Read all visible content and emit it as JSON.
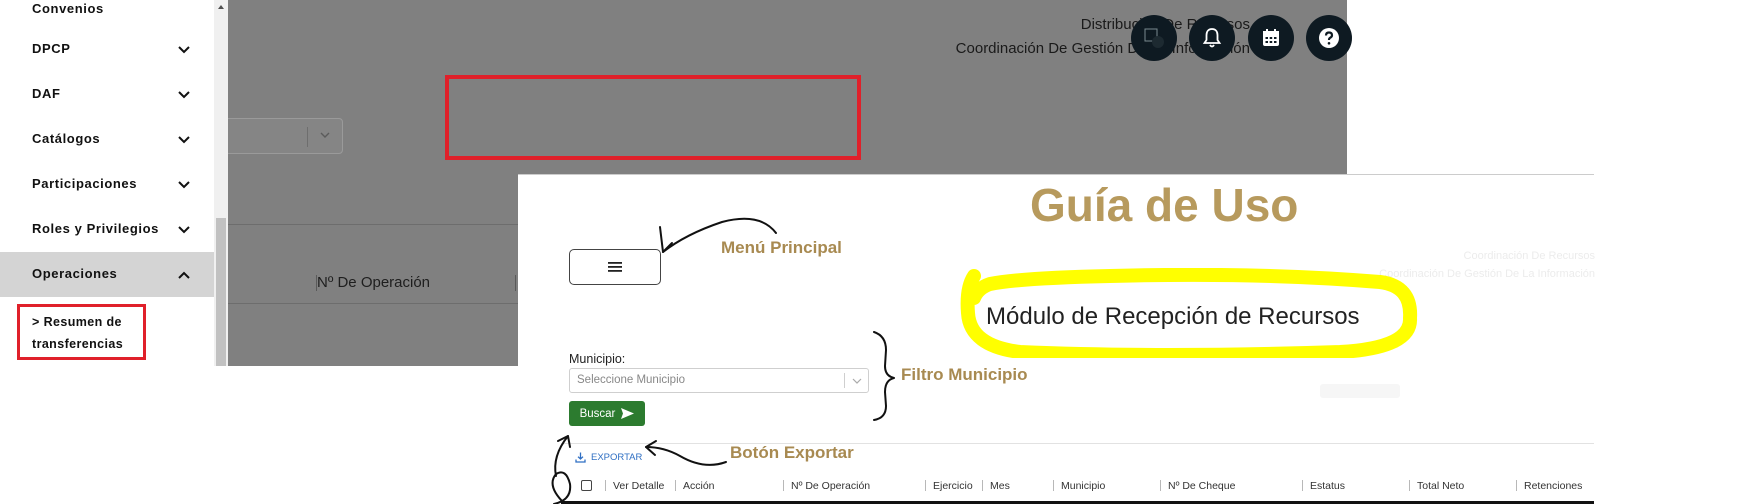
{
  "header": {
    "line1": "Distribución De Recursos",
    "line2": "Coordinación De Gestión De La Información",
    "icons": [
      "avatar",
      "bell-icon",
      "calendar-icon",
      "help-icon"
    ]
  },
  "sidebar": {
    "items": [
      {
        "label": "Convenios",
        "expanded": false
      },
      {
        "label": "DPCP",
        "expanded": false
      },
      {
        "label": "DAF",
        "expanded": false
      },
      {
        "label": "Catálogos",
        "expanded": false
      },
      {
        "label": "Participaciones",
        "expanded": false
      },
      {
        "label": "Roles y Privilegios",
        "expanded": false
      },
      {
        "label": "Operaciones",
        "expanded": true
      }
    ],
    "submenu": {
      "label": "> Resumen de transferencias"
    }
  },
  "background": {
    "column_label": "Nº De Operación"
  },
  "guide": {
    "title": "Guía de Uso",
    "module_title": "Módulo de Recepción de Recursos",
    "faded_line1": "Coordinación De Recursos",
    "faded_line2": "Coordinación De Gestión De La Información",
    "annotations": {
      "menu": "Menú Principal",
      "filter": "Filtro Municipio",
      "export": "Botón Exportar"
    },
    "municipio_label": "Municipio:",
    "municipio_placeholder": "Seleccione Municipio",
    "buscar_label": "Buscar",
    "exportar_label": "EXPORTAR",
    "table_headers": [
      "Ver Detalle",
      "Acción",
      "Nº De Operación",
      "Ejercicio",
      "Mes",
      "Municipio",
      "Nº De Cheque",
      "Estatus",
      "Total Neto",
      "Retenciones"
    ]
  },
  "colors": {
    "overlay": "#808080",
    "highlight_red": "#e0202a",
    "annotation_tan": "#a88a51",
    "highlight_yellow": "#ffff00",
    "primary_green": "#2c7b2f",
    "link_blue": "#2f6fc3"
  }
}
